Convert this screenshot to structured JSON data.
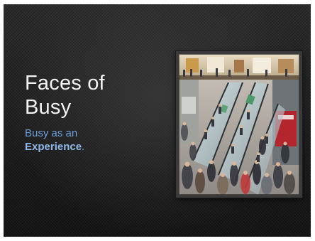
{
  "slide": {
    "title_line1": "Faces of",
    "title_line2": "Busy",
    "subtitle_line1": "Busy as an",
    "subtitle_emphasis": "Experience",
    "subtitle_end": "."
  },
  "colors": {
    "title": "#f2f2f2",
    "subtitle": "#6f9fd8",
    "background": "#1d1d1d"
  },
  "photo": {
    "subject": "crowded-escalators-in-shopping-mall"
  }
}
